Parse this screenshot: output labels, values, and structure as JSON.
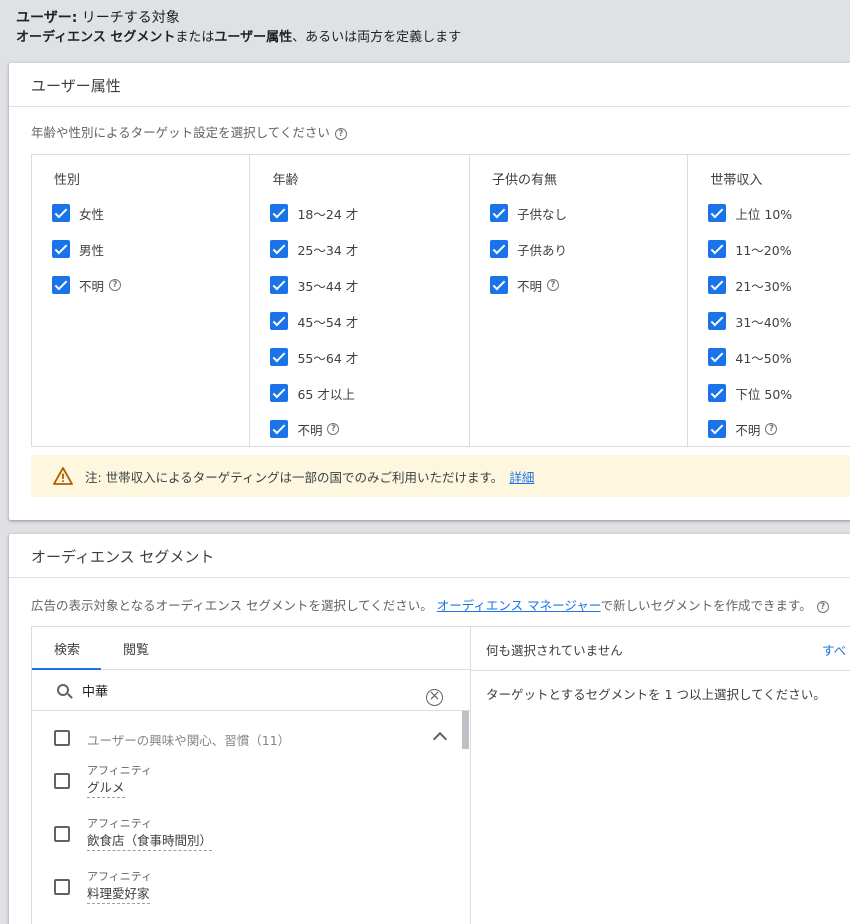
{
  "header": {
    "line1_bold": "ユーザー:",
    "line1_rest": " リーチする対象",
    "line2_bold1": "オーディエンス セグメント",
    "line2_mid": "または",
    "line2_bold2": "ユーザー属性",
    "line2_rest": "、あるいは両方を定義します"
  },
  "demographics": {
    "title": "ユーザー属性",
    "subtitle": "年齢や性別によるターゲット設定を選択してください",
    "help_glyph": "?",
    "columns": [
      {
        "header": "性別",
        "options": [
          {
            "label": "女性",
            "help": false
          },
          {
            "label": "男性",
            "help": false
          },
          {
            "label": "不明",
            "help": true
          }
        ]
      },
      {
        "header": "年齢",
        "options": [
          {
            "label": "18～24 才",
            "help": false
          },
          {
            "label": "25～34 才",
            "help": false
          },
          {
            "label": "35～44 才",
            "help": false
          },
          {
            "label": "45～54 才",
            "help": false
          },
          {
            "label": "55～64 才",
            "help": false
          },
          {
            "label": "65 才以上",
            "help": false
          },
          {
            "label": "不明",
            "help": true
          }
        ]
      },
      {
        "header": "子供の有無",
        "options": [
          {
            "label": "子供なし",
            "help": false
          },
          {
            "label": "子供あり",
            "help": false
          },
          {
            "label": "不明",
            "help": true
          }
        ]
      },
      {
        "header": "世帯収入",
        "options": [
          {
            "label": "上位 10%",
            "help": false
          },
          {
            "label": "11～20%",
            "help": false
          },
          {
            "label": "21～30%",
            "help": false
          },
          {
            "label": "31～40%",
            "help": false
          },
          {
            "label": "41～50%",
            "help": false
          },
          {
            "label": "下位 50%",
            "help": false
          },
          {
            "label": "不明",
            "help": true
          }
        ]
      }
    ],
    "note_text": "注: 世帯収入によるターゲティングは一部の国でのみご利用いただけます。",
    "note_link": "詳細"
  },
  "audience": {
    "title": "オーディエンス セグメント",
    "desc_pre": "広告の表示対象となるオーディエンス セグメントを選択してください。",
    "desc_link": "オーディエンス マネージャー",
    "desc_post": "で新しいセグメントを作成できます。",
    "tabs": [
      "検索",
      "閲覧"
    ],
    "search_value": "中華",
    "clear_glyph": "×",
    "category_label": "ユーザーの興味や関心、習慣（11）",
    "results": [
      {
        "type": "アフィニティ",
        "name": "グルメ"
      },
      {
        "type": "アフィニティ",
        "name": "飲食店（食事時間別）"
      },
      {
        "type": "アフィニティ",
        "name": "料理愛好家"
      }
    ],
    "selected_header": "何も選択されていません",
    "selected_link": "すべ",
    "selected_message": "ターゲットとするセグメントを 1 つ以上選択してください。"
  },
  "colors": {
    "accent": "#1a73e8",
    "warning_bg": "#fef7e0",
    "page_bg": "#dfe1e5"
  }
}
